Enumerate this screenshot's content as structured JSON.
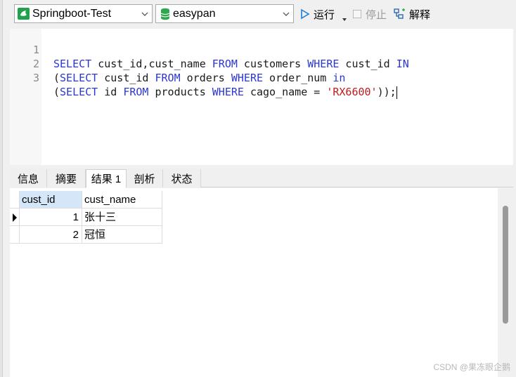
{
  "toolbar": {
    "connection": "Springboot-Test",
    "database": "easypan",
    "run_label": "运行",
    "stop_label": "停止",
    "explain_label": "解释"
  },
  "editor": {
    "line_numbers": [
      "1",
      "2",
      "3"
    ]
  },
  "tabs": [
    "信息",
    "摘要",
    "结果 1",
    "剖析",
    "状态"
  ],
  "results": {
    "columns": [
      "cust_id",
      "cust_name"
    ],
    "rows": [
      {
        "cust_id": "1",
        "cust_name": "张十三"
      },
      {
        "cust_id": "2",
        "cust_name": "冠恒"
      }
    ]
  },
  "watermark": "CSDN @果冻眼企鹅",
  "colors": {
    "keyword": "#2b36d3",
    "string": "#c21a1a",
    "selected_header": "#d4e6f7",
    "run_icon": "#1e7fd8"
  }
}
